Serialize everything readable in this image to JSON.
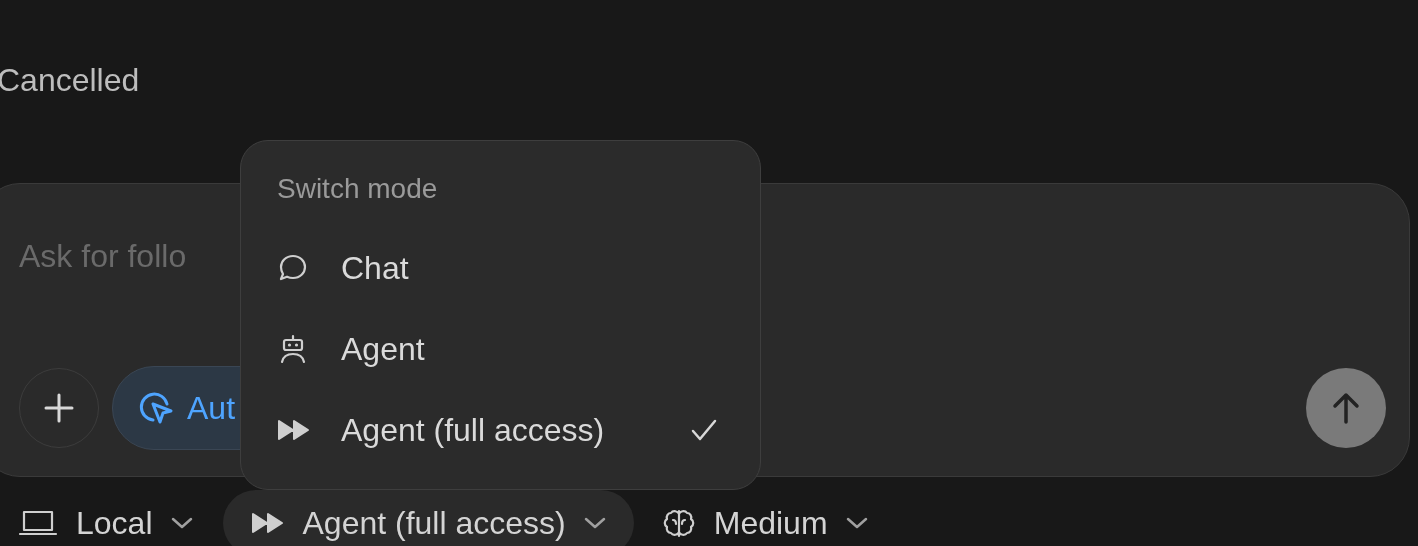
{
  "status_text": "Cancelled",
  "composer": {
    "placeholder": "Ask for follo",
    "auto_button": {
      "label": "Aut"
    }
  },
  "mode_menu": {
    "title": "Switch mode",
    "items": [
      {
        "label": "Chat",
        "kind": "chat",
        "selected": false
      },
      {
        "label": "Agent",
        "kind": "agent",
        "selected": false
      },
      {
        "label": "Agent (full access)",
        "kind": "agent_full",
        "selected": true
      }
    ]
  },
  "bottom_bar": {
    "items": [
      {
        "label": "Local",
        "kind": "local",
        "expanded": false
      },
      {
        "label": "Agent (full access)",
        "kind": "agent_full",
        "expanded": true
      },
      {
        "label": "Medium",
        "kind": "reasoning",
        "expanded": false
      }
    ]
  }
}
